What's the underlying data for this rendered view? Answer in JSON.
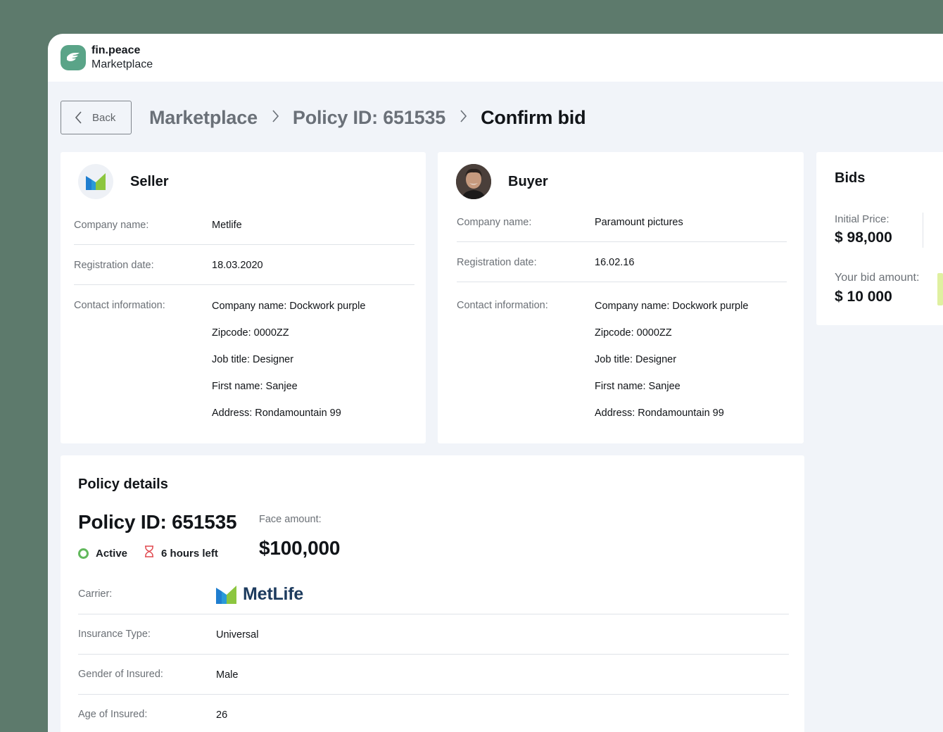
{
  "brand": {
    "name": "fin.peace",
    "section": "Marketplace",
    "logo_icon": "dove-logo-icon",
    "color": "#5aa488"
  },
  "nav": {
    "back_label": "Back",
    "breadcrumbs": [
      "Marketplace",
      "Policy ID: 651535",
      "Confirm bid"
    ]
  },
  "seller": {
    "title": "Seller",
    "avatar_icon": "metlife-logo-icon",
    "fields": [
      {
        "label": "Company name:",
        "value": "Metlife"
      },
      {
        "label": "Registration date:",
        "value": "18.03.2020"
      }
    ],
    "contact_label": "Contact information:",
    "contact": [
      "Company name: Dockwork purple",
      "Zipcode: 0000ZZ",
      "Job title: Designer",
      "First name: Sanjee",
      "Address: Rondamountain 99"
    ]
  },
  "buyer": {
    "title": "Buyer",
    "avatar_icon": "user-avatar",
    "fields": [
      {
        "label": "Company name:",
        "value": "Paramount pictures"
      },
      {
        "label": "Registration date:",
        "value": "16.02.16"
      }
    ],
    "contact_label": "Contact information:",
    "contact": [
      "Company name: Dockwork purple",
      "Zipcode: 0000ZZ",
      "Job title: Designer",
      "First name: Sanjee",
      "Address: Rondamountain 99"
    ]
  },
  "bids": {
    "title": "Bids",
    "initial_label": "Initial Price:",
    "initial_value": "$ 98,000",
    "bid_label": "Your bid amount:",
    "bid_value": "$ 10 000"
  },
  "policy": {
    "title": "Policy details",
    "id_label": "Policy ID: 651535",
    "status": "Active",
    "time_left": "6 hours left",
    "face_label": "Face amount:",
    "face_value": "$100,000",
    "carrier_label": "Carrier:",
    "carrier_name": "MetLife",
    "rows": [
      {
        "label": "Insurance Type:",
        "value": "Universal"
      },
      {
        "label": "Gender of Insured:",
        "value": "Male"
      },
      {
        "label": "Age of Insured:",
        "value": "26"
      }
    ]
  },
  "colors": {
    "frame": "#5d7a6c",
    "background": "#f1f4f9",
    "status_active": "#62b85c",
    "timer": "#e0494f",
    "metlife_blue": "#1f7ed0",
    "metlife_green": "#8cc63f"
  }
}
